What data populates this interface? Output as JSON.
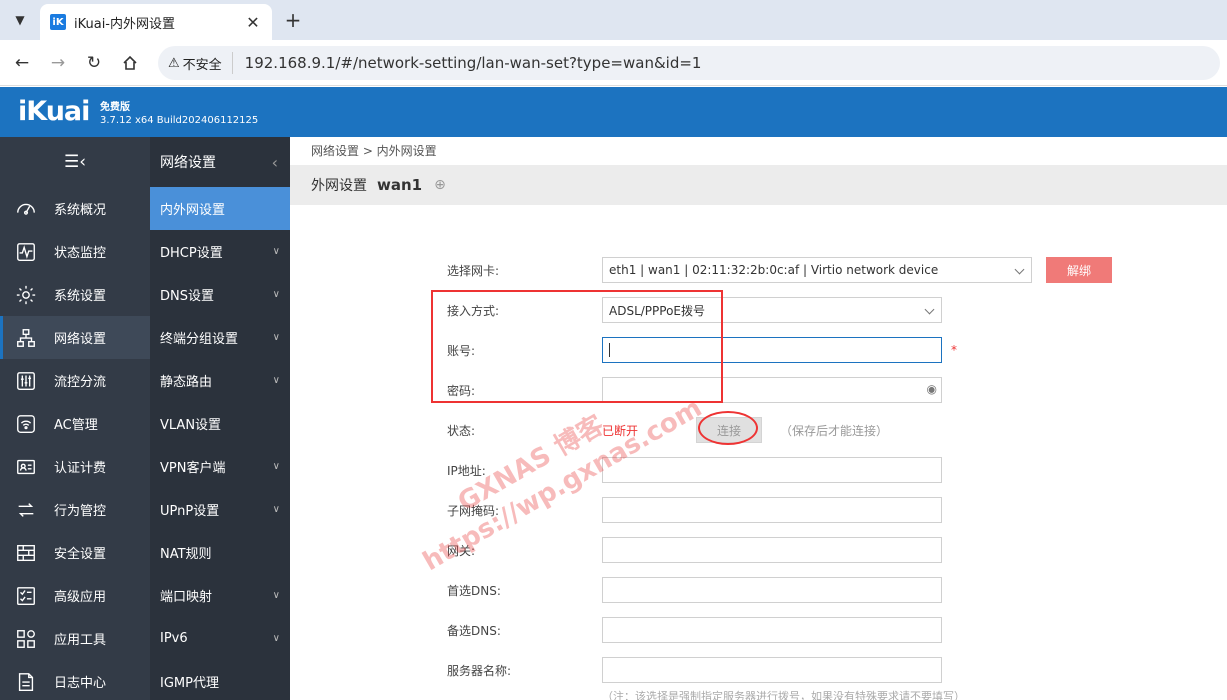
{
  "browser": {
    "tab_title": "iKuai-内外网设置",
    "tab_favicon": "iK",
    "insecure_label": "不安全",
    "url": "192.168.9.1/#/network-setting/lan-wan-set?type=wan&id=1"
  },
  "header": {
    "logo": "iKuai",
    "edition": "免费版",
    "build": "3.7.12 x64 Build202406112125"
  },
  "sidebar_main": [
    {
      "label": "系统概况",
      "icon": "dashboard-icon"
    },
    {
      "label": "状态监控",
      "icon": "pulse-icon"
    },
    {
      "label": "系统设置",
      "icon": "gear-icon"
    },
    {
      "label": "网络设置",
      "icon": "network-icon",
      "active": true
    },
    {
      "label": "流控分流",
      "icon": "sliders-icon"
    },
    {
      "label": "AC管理",
      "icon": "wifi-icon"
    },
    {
      "label": "认证计费",
      "icon": "id-card-icon"
    },
    {
      "label": "行为管控",
      "icon": "arrows-icon"
    },
    {
      "label": "安全设置",
      "icon": "firewall-icon"
    },
    {
      "label": "高级应用",
      "icon": "checklist-icon"
    },
    {
      "label": "应用工具",
      "icon": "apps-icon"
    },
    {
      "label": "日志中心",
      "icon": "log-icon"
    }
  ],
  "sidebar_sub": {
    "title": "网络设置",
    "items": [
      {
        "label": "内外网设置",
        "active": true,
        "chevron": false
      },
      {
        "label": "DHCP设置",
        "chevron": true
      },
      {
        "label": "DNS设置",
        "chevron": true
      },
      {
        "label": "终端分组设置",
        "chevron": true
      },
      {
        "label": "静态路由",
        "chevron": true
      },
      {
        "label": "VLAN设置",
        "chevron": false
      },
      {
        "label": "VPN客户端",
        "chevron": true
      },
      {
        "label": "UPnP设置",
        "chevron": true
      },
      {
        "label": "NAT规则",
        "chevron": false
      },
      {
        "label": "端口映射",
        "chevron": true
      },
      {
        "label": "IPv6",
        "chevron": true
      },
      {
        "label": "IGMP代理",
        "chevron": false
      }
    ]
  },
  "breadcrumb": "网络设置 > 内外网设置",
  "page": {
    "title": "外网设置",
    "iface": "wan1"
  },
  "form": {
    "nic_label": "选择网卡:",
    "nic_value": "eth1 | wan1 | 02:11:32:2b:0c:af | Virtio network device",
    "unbind": "解绑",
    "access_label": "接入方式:",
    "access_value": "ADSL/PPPoE拨号",
    "account_label": "账号:",
    "required_mark": "*",
    "password_label": "密码:",
    "status_label": "状态:",
    "status_value": "已断开",
    "connect": "连接",
    "connect_hint": "（保存后才能连接）",
    "ip_label": "IP地址:",
    "mask_label": "子网掩码:",
    "gateway_label": "网关:",
    "dns1_label": "首选DNS:",
    "dns2_label": "备选DNS:",
    "server_label": "服务器名称:",
    "note": "（注：该选择是强制指定服务器进行拨号，如果没有特殊要求请不要填写）"
  },
  "watermark": [
    "GXNAS 博客",
    "https://wp.gxnas.com"
  ],
  "colors": {
    "header_blue": "#1c73c0",
    "sidebar_dark": "#333b47",
    "submenu_active": "#4a90d9",
    "danger": "#e33333"
  }
}
